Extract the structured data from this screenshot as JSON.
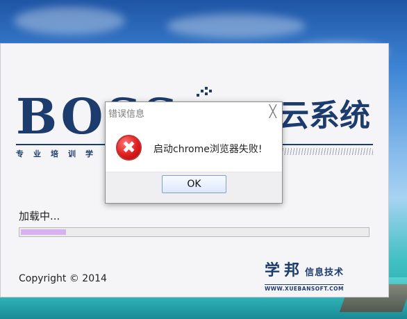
{
  "splash": {
    "logo_text": "BOSS",
    "title": "云系统",
    "subtitle": "专业培训学",
    "loading_label": "加载中...",
    "progress": 0.13,
    "copyright": "Copyright © 2014",
    "brand": {
      "cn_large": "学邦",
      "cn_small": "信息技术",
      "url": "WWW.XUEBANSOFT.COM"
    }
  },
  "dialog": {
    "title": "错误信息",
    "close_glyph": "╳",
    "icon": "error-icon",
    "icon_glyph": "✖",
    "message": "启动chrome浏览器失败!",
    "ok_label": "OK"
  },
  "colors": {
    "logo_navy": "#1d3c6e",
    "progress_fill": "#d8b2ef",
    "error_red": "#e01d1d"
  }
}
